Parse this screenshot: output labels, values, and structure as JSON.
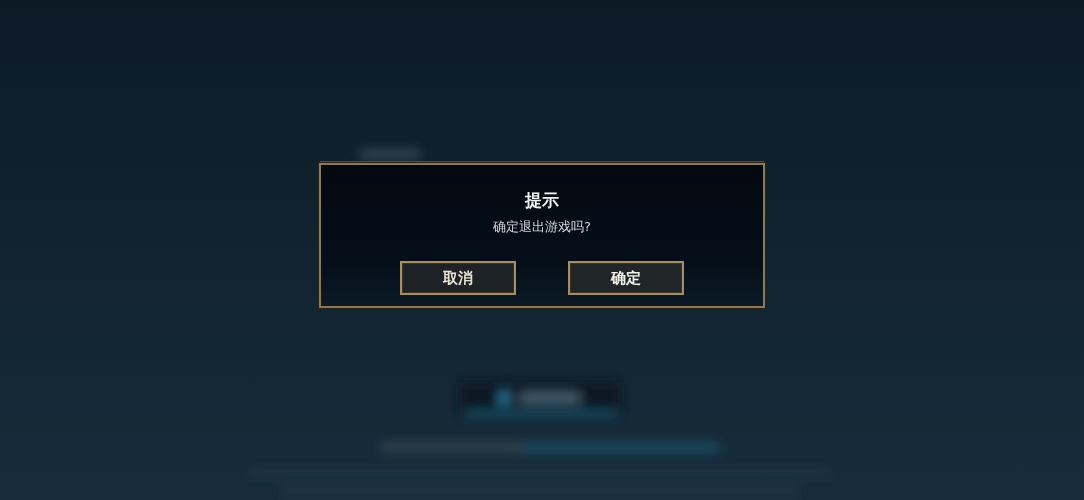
{
  "dialog": {
    "title": "提示",
    "message": "确定退出游戏吗?",
    "buttons": [
      {
        "label": "取消",
        "kind": "cancel"
      },
      {
        "label": "确定",
        "kind": "confirm"
      }
    ]
  }
}
